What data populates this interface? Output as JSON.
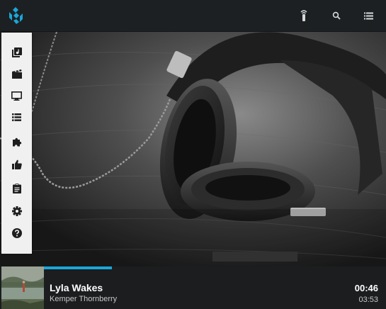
{
  "header": {
    "logo_icon": "kodi-logo-icon",
    "accent_color": "#1aa6d9",
    "buttons": [
      {
        "name": "remote-icon"
      },
      {
        "name": "search-icon"
      },
      {
        "name": "menu-icon"
      }
    ]
  },
  "sidebar": {
    "items": [
      {
        "icon": "music-library-icon"
      },
      {
        "icon": "movies-icon"
      },
      {
        "icon": "tv-shows-icon"
      },
      {
        "icon": "playlist-icon"
      },
      {
        "icon": "addons-icon"
      },
      {
        "icon": "thumbs-up-icon"
      },
      {
        "icon": "clipboard-icon"
      },
      {
        "icon": "settings-icon"
      },
      {
        "icon": "help-icon"
      }
    ]
  },
  "player": {
    "title": "Lyla Wakes",
    "artist": "Kemper Thornberry",
    "current_time": "00:46",
    "total_time": "03:53",
    "progress_fraction": 0.197
  }
}
